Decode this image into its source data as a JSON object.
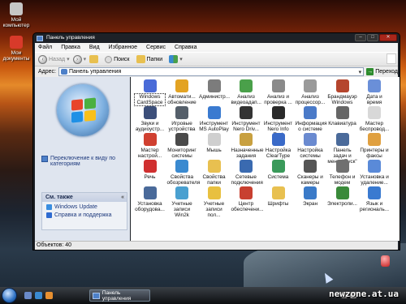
{
  "desktop": {
    "icons": [
      {
        "label": "Мой компьютер",
        "icon": "my-computer-icon",
        "color": "#c6c6c6"
      },
      {
        "label": "Мои документы",
        "icon": "my-documents-icon",
        "color": "#d83a2a"
      }
    ],
    "recycle_bin_label": "",
    "watermark": "newzone.at.ua"
  },
  "window": {
    "title": "Панель управления",
    "menu": [
      "Файл",
      "Правка",
      "Вид",
      "Избранное",
      "Сервис",
      "Справка"
    ],
    "toolbar": {
      "back_label": "Назад",
      "forward_label": "",
      "search_label": "Поиск",
      "folders_label": "Папки"
    },
    "address": {
      "label": "Адрес:",
      "value": "Панель управления",
      "go_label": "Переход"
    },
    "left_panel": {
      "switch_view_label": "Переключение к виду по категориям",
      "see_also_title": "См. также",
      "see_also_links": [
        {
          "label": "Windows Update",
          "icon": "windows-update-icon",
          "color": "#3a8ee0"
        },
        {
          "label": "Справка и поддержка",
          "icon": "help-icon",
          "color": "#2f6bd0"
        }
      ]
    },
    "items": [
      {
        "label": "Windows CardSpace",
        "icon": "cardspace-icon",
        "color": "#4a6bd8",
        "selected": true
      },
      {
        "label": "Автомати... обновление",
        "icon": "auto-update-icon",
        "color": "#e3a323"
      },
      {
        "label": "Администр...",
        "icon": "admin-tools-icon",
        "color": "#7c7c7c"
      },
      {
        "label": "Анализ видеоадап...",
        "icon": "video-analyzer-icon",
        "color": "#4aa04a"
      },
      {
        "label": "Анализ и проверка ...",
        "icon": "disk-check-icon",
        "color": "#8a8a8a"
      },
      {
        "label": "Анализ процессор...",
        "icon": "cpu-analyzer-icon",
        "color": "#9a9a9a"
      },
      {
        "label": "Брандмауэр Windows",
        "icon": "firewall-icon",
        "color": "#b5452d"
      },
      {
        "label": "Дата и время",
        "icon": "date-time-icon",
        "color": "#6a8fd8"
      },
      {
        "label": "Звуки и аудиоустр...",
        "icon": "sound-icon",
        "color": "#3c4f7a"
      },
      {
        "label": "Игровые устройства",
        "icon": "game-controller-icon",
        "color": "#555f6a"
      },
      {
        "label": "Инструмент MS AutoPlay",
        "icon": "autoplay-icon",
        "color": "#3a7ad0"
      },
      {
        "label": "Инструмент Nero Driv...",
        "icon": "nero-drive-icon",
        "color": "#333333"
      },
      {
        "label": "Инструмент Nero Info Tool",
        "icon": "nero-info-icon",
        "color": "#2a2a2a"
      },
      {
        "label": "Информация о системе",
        "icon": "system-info-icon",
        "color": "#4a7ac8"
      },
      {
        "label": "Клавиатура",
        "icon": "keyboard-icon",
        "color": "#666666"
      },
      {
        "label": "Мастер беспровод...",
        "icon": "wireless-wizard-icon",
        "color": "#d8d8d8"
      },
      {
        "label": "Мастер настрой...",
        "icon": "setup-wizard-icon",
        "color": "#d04030"
      },
      {
        "label": "Мониторинг системы",
        "icon": "system-monitor-icon",
        "color": "#4a4a4a"
      },
      {
        "label": "Мышь",
        "icon": "mouse-icon",
        "color": "#cfcfcf"
      },
      {
        "label": "Назначенные задания",
        "icon": "scheduled-tasks-icon",
        "color": "#c8a040"
      },
      {
        "label": "Настройка ClearType",
        "icon": "cleartype-icon",
        "color": "#3a6ac8"
      },
      {
        "label": "Настройка системы",
        "icon": "system-settings-icon",
        "color": "#6a8ad0"
      },
      {
        "label": "Панель задач и меню \"Пуск\"",
        "icon": "taskbar-start-icon",
        "color": "#4a6a9a"
      },
      {
        "label": "Принтеры и факсы",
        "icon": "printers-icon",
        "color": "#e0a040"
      },
      {
        "label": "Речь",
        "icon": "speech-icon",
        "color": "#d03030"
      },
      {
        "label": "Свойства обозревателя",
        "icon": "internet-options-icon",
        "color": "#3a8ad0"
      },
      {
        "label": "Свойства папки",
        "icon": "folder-options-icon",
        "color": "#e8c050"
      },
      {
        "label": "Сетевые подключения",
        "icon": "network-connections-icon",
        "color": "#3a6ab0"
      },
      {
        "label": "Система",
        "icon": "system-icon",
        "color": "#3a9a5a"
      },
      {
        "label": "Сканеры и камеры",
        "icon": "scanners-icon",
        "color": "#555555"
      },
      {
        "label": "Телефон и модем",
        "icon": "phone-modem-icon",
        "color": "#707070"
      },
      {
        "label": "Установка и удаление...",
        "icon": "add-remove-icon",
        "color": "#5a8ad8"
      },
      {
        "label": "Установка оборудова...",
        "icon": "add-hardware-icon",
        "color": "#4a6a9a"
      },
      {
        "label": "Учетные записи Win2k",
        "icon": "user-accounts-2k-icon",
        "color": "#4aa0d0"
      },
      {
        "label": "Учетные записи пол...",
        "icon": "user-accounts-icon",
        "color": "#e8c040"
      },
      {
        "label": "Центр обеспечени...",
        "icon": "security-center-icon",
        "color": "#c84030"
      },
      {
        "label": "Шрифты",
        "icon": "fonts-icon",
        "color": "#e8c050"
      },
      {
        "label": "Экран",
        "icon": "display-icon",
        "color": "#3a7ac8"
      },
      {
        "label": "Электропи...",
        "icon": "power-icon",
        "color": "#3a8a3a"
      },
      {
        "label": "Язык и региональ...",
        "icon": "regional-icon",
        "color": "#3a7ad0"
      }
    ],
    "status": "Объектов: 40"
  },
  "taskbar": {
    "task_label": "Панель управления"
  }
}
